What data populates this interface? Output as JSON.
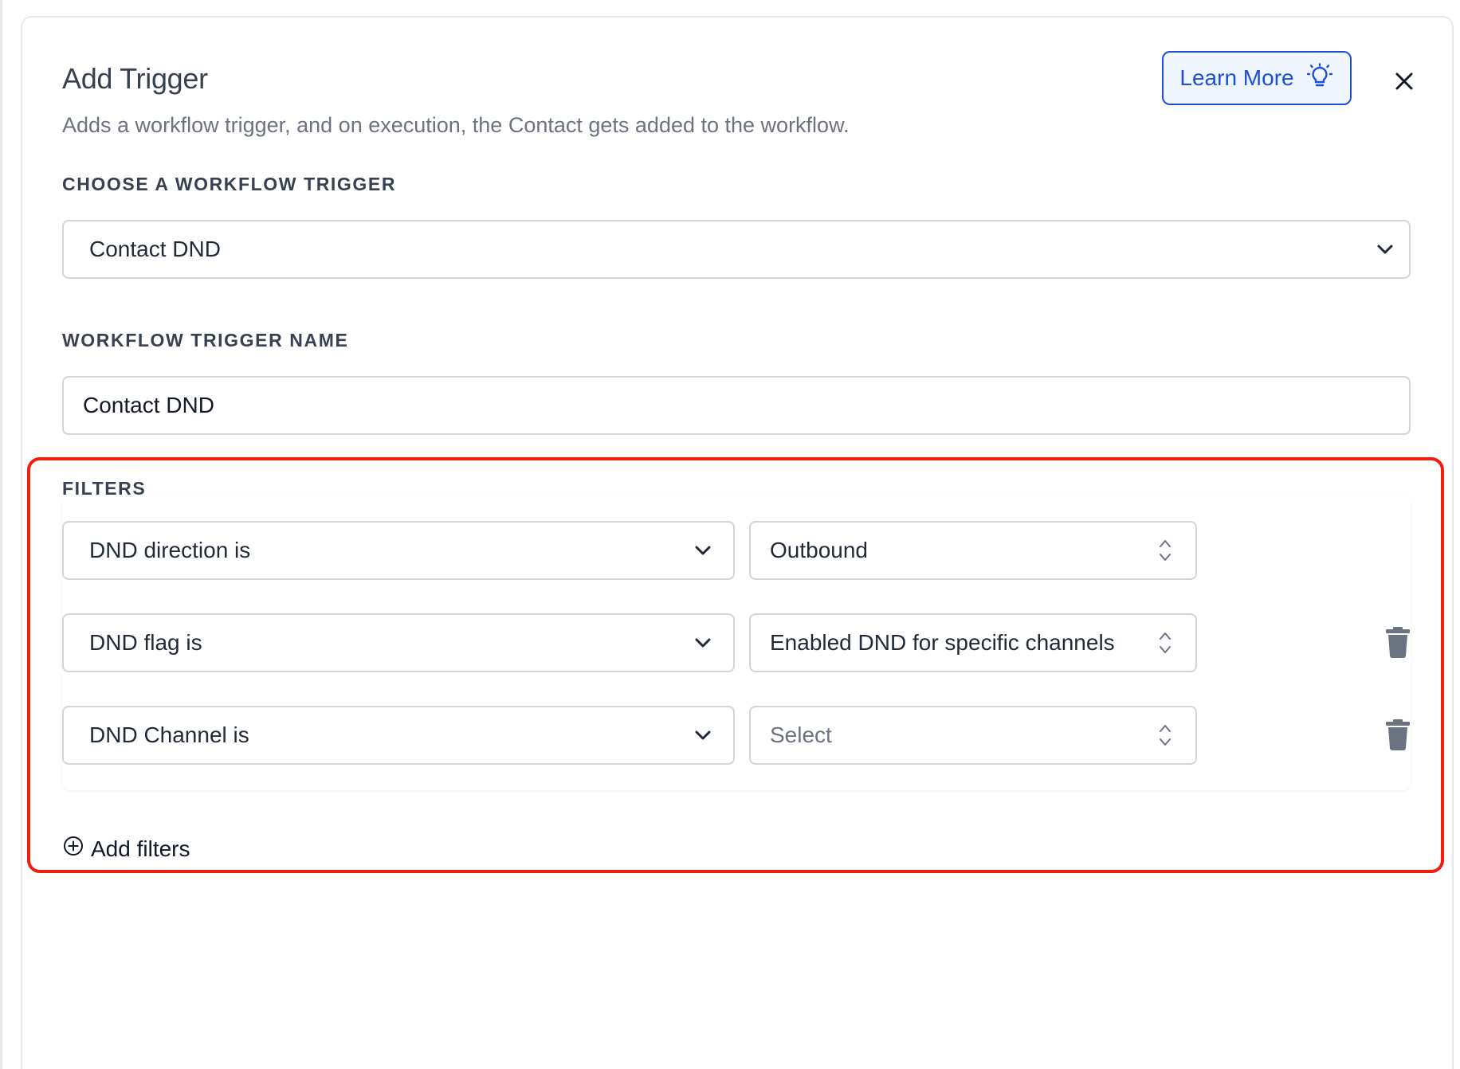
{
  "header": {
    "title": "Add Trigger",
    "subtitle": "Adds a workflow trigger, and on execution, the Contact gets added to the workflow.",
    "learn_more_label": "Learn More"
  },
  "trigger": {
    "label": "CHOOSE A WORKFLOW TRIGGER",
    "selected": "Contact DND"
  },
  "trigger_name": {
    "label": "WORKFLOW TRIGGER NAME",
    "value": "Contact DND"
  },
  "filters": {
    "label": "FILTERS",
    "rows": [
      {
        "field": "DND direction is",
        "value": "Outbound",
        "is_placeholder": false,
        "deletable": false
      },
      {
        "field": "DND flag is",
        "value": "Enabled DND for specific channels",
        "is_placeholder": false,
        "deletable": true
      },
      {
        "field": "DND Channel is",
        "value": "Select",
        "is_placeholder": true,
        "deletable": true
      }
    ],
    "add_label": "Add filters"
  },
  "colors": {
    "accent": "#1d4ed8",
    "highlight_border": "#ef1f0f",
    "text_primary": "#374151",
    "text_muted": "#6b7280",
    "icon_gray": "#6b7280"
  },
  "icons": {
    "learn_more": "lightbulb-icon",
    "close": "close-icon",
    "dropdown": "chevron-down-icon",
    "sorter": "up-down-chevron-icon",
    "delete": "trash-icon",
    "add": "plus-circle-icon"
  }
}
